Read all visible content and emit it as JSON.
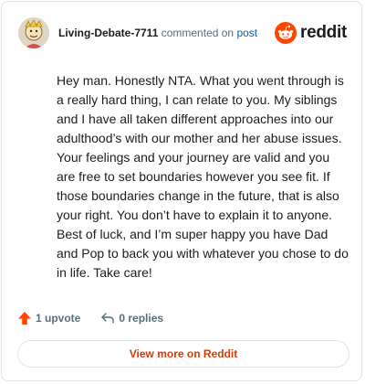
{
  "comment": {
    "username": "Living-Debate-7711",
    "action_text": "commented on",
    "post_link": "post",
    "body": "Hey man. Honestly NTA. What you went through is a really hard thing, I can relate to you. My siblings and I have all taken different approaches into our adulthood’s with our mother and her abuse issues. Your feelings and your journey are valid and you are free to set boundaries however you see fit. If those boundaries change in the future, that is also your right. You don’t have to explain it to anyone. Best of luck, and I’m super happy you have Dad and Pop to back you with whatever you chose to do in life. Take care!",
    "upvotes": "1 upvote",
    "replies": "0 replies"
  },
  "brand": {
    "name": "reddit",
    "color": "#ff4500"
  },
  "footer": {
    "view_more_label": "View more on Reddit"
  },
  "icons": {
    "avatar": "avatar",
    "logo": "reddit-logo-icon",
    "upvote": "upvote-arrow-icon",
    "reply": "reply-icon"
  },
  "colors": {
    "accent": "#d93900",
    "link": "#0a64a8",
    "muted": "#576f76"
  }
}
